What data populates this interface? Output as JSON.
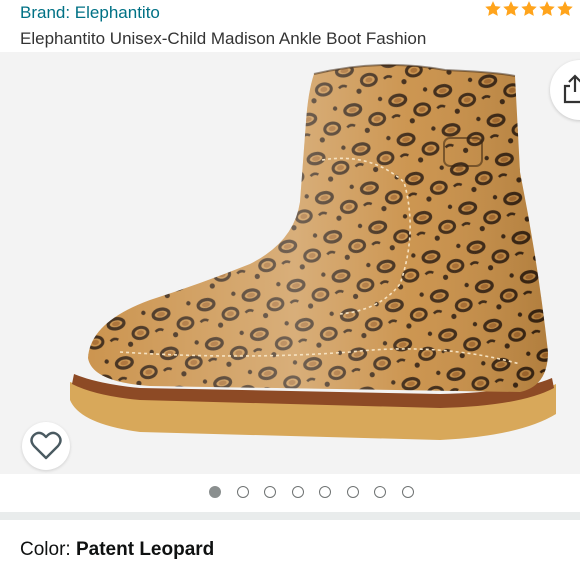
{
  "header": {
    "brand": "Brand: Elephantito",
    "title": "Elephantito Unisex-Child Madison Ankle Boot Fashion",
    "rating_stars": 5
  },
  "gallery": {
    "image_count": 8,
    "active_index": 0,
    "share_icon": "share-icon",
    "wishlist_icon": "heart-icon"
  },
  "variation": {
    "label": "Color: ",
    "value": "Patent Leopard"
  },
  "colors": {
    "link": "#007185",
    "star": "#ffa41c",
    "image_bg": "#f3f3f3"
  }
}
